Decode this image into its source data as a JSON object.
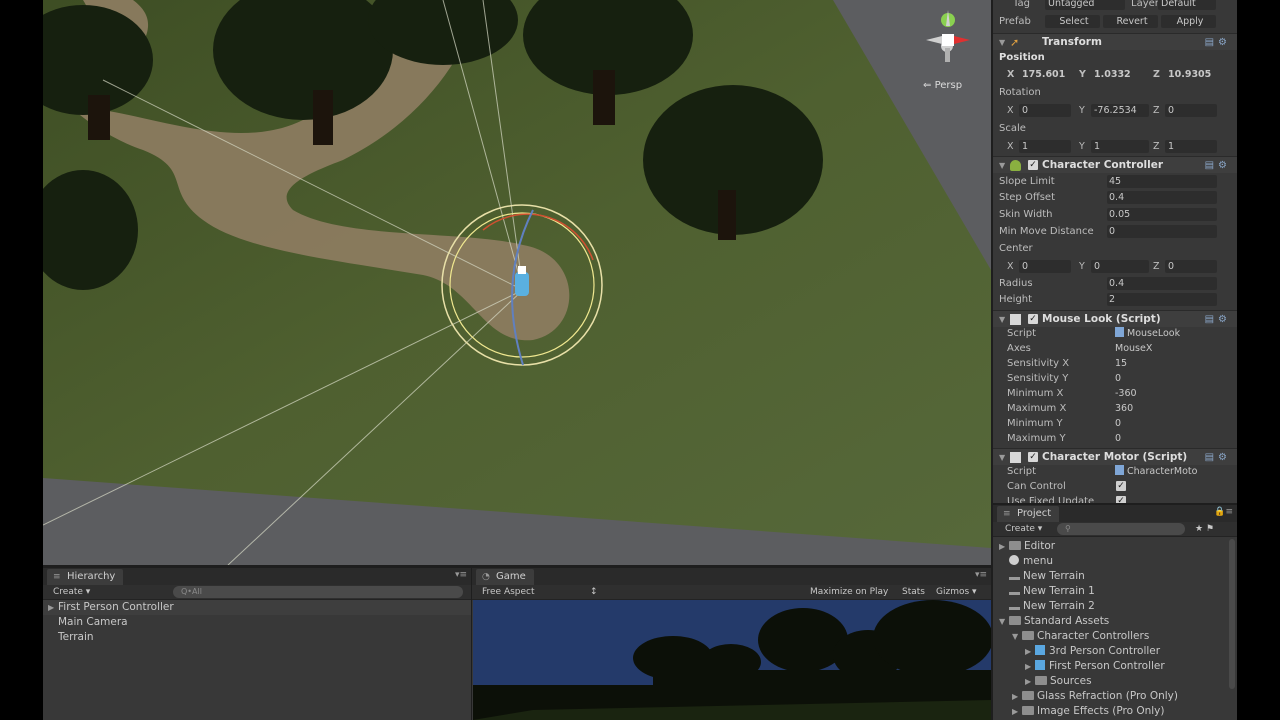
{
  "scene": {
    "projection_label": "Persp",
    "gizmo_axis_labels": [
      "y",
      "x"
    ]
  },
  "hierarchy": {
    "tab_label": "Hierarchy",
    "create_label": "Create",
    "search_placeholder": "Q•All",
    "items": [
      {
        "label": "First Person Controller",
        "expandable": true,
        "selected": true
      },
      {
        "label": "Main Camera",
        "expandable": false,
        "selected": false
      },
      {
        "label": "Terrain",
        "expandable": false,
        "selected": false
      }
    ]
  },
  "game": {
    "tab_label": "Game",
    "aspect_label": "Free Aspect",
    "toolbar": [
      "Maximize on Play",
      "Stats",
      "Gizmos"
    ]
  },
  "inspector": {
    "tag_label": "Tag",
    "tag_value": "Untagged",
    "layer_label": "Layer",
    "layer_value": "Default",
    "prefab_label": "Prefab",
    "prefab_buttons": [
      "Select",
      "Revert",
      "Apply"
    ],
    "transform": {
      "title": "Transform",
      "position_label": "Position",
      "position": {
        "x": "175.601",
        "y": "1.0332",
        "z": "10.9305"
      },
      "rotation_label": "Rotation",
      "rotation": {
        "x": "0",
        "y": "-76.2534",
        "z": "0"
      },
      "scale_label": "Scale",
      "scale": {
        "x": "1",
        "y": "1",
        "z": "1"
      }
    },
    "character_controller": {
      "title": "Character Controller",
      "slope_limit_label": "Slope Limit",
      "slope_limit": "45",
      "step_offset_label": "Step Offset",
      "step_offset": "0.4",
      "skin_width_label": "Skin Width",
      "skin_width": "0.05",
      "min_move_label": "Min Move Distance",
      "min_move": "0",
      "center_label": "Center",
      "center": {
        "x": "0",
        "y": "0",
        "z": "0"
      },
      "radius_label": "Radius",
      "radius": "0.4",
      "height_label": "Height",
      "height": "2"
    },
    "mouse_look": {
      "title": "Mouse Look (Script)",
      "script_label": "Script",
      "script": "MouseLook",
      "axes_label": "Axes",
      "axes": "MouseX",
      "sens_x_label": "Sensitivity X",
      "sens_x": "15",
      "sens_y_label": "Sensitivity Y",
      "sens_y": "0",
      "min_x_label": "Minimum X",
      "min_x": "-360",
      "max_x_label": "Maximum X",
      "max_x": "360",
      "min_y_label": "Minimum Y",
      "min_y": "0",
      "max_y_label": "Maximum Y",
      "max_y": "0"
    },
    "character_motor": {
      "title": "Character Motor (Script)",
      "script_label": "Script",
      "script": "CharacterMoto",
      "can_control_label": "Can Control",
      "fixed_update_label": "Use Fixed Update"
    },
    "xyz_labels": {
      "x": "X",
      "y": "Y",
      "z": "Z"
    }
  },
  "project": {
    "tab_label": "Project",
    "create_label": "Create",
    "items": [
      {
        "label": "Editor",
        "icon": "folder",
        "indent": 0,
        "arrow": "▶"
      },
      {
        "label": "menu",
        "icon": "unity",
        "indent": 0,
        "arrow": ""
      },
      {
        "label": "New Terrain",
        "icon": "terrain",
        "indent": 0,
        "arrow": ""
      },
      {
        "label": "New Terrain 1",
        "icon": "terrain",
        "indent": 0,
        "arrow": ""
      },
      {
        "label": "New Terrain 2",
        "icon": "terrain",
        "indent": 0,
        "arrow": ""
      },
      {
        "label": "Standard Assets",
        "icon": "folder",
        "indent": 0,
        "arrow": "▼"
      },
      {
        "label": "Character Controllers",
        "icon": "folder",
        "indent": 1,
        "arrow": "▼"
      },
      {
        "label": "3rd Person Controller",
        "icon": "prefab",
        "indent": 2,
        "arrow": "▶"
      },
      {
        "label": "First Person Controller",
        "icon": "prefab",
        "indent": 2,
        "arrow": "▶"
      },
      {
        "label": "Sources",
        "icon": "folder",
        "indent": 2,
        "arrow": "▶"
      },
      {
        "label": "Glass Refraction (Pro Only)",
        "icon": "folder",
        "indent": 1,
        "arrow": "▶"
      },
      {
        "label": "Image Effects (Pro Only)",
        "icon": "folder",
        "indent": 1,
        "arrow": "▶"
      }
    ]
  },
  "colors": {
    "grass": "#4a5a2c",
    "path": "#8a7a5e",
    "sky": "#1f3563",
    "panel": "#383838",
    "selection_gizmo": "#e8d080"
  }
}
